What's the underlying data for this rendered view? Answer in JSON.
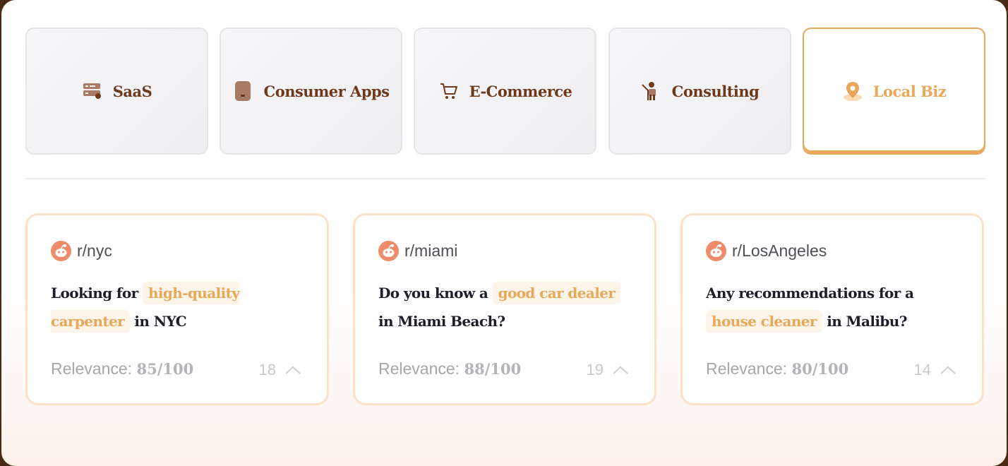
{
  "tabs": [
    {
      "label": "SaaS",
      "icon": "server-icon",
      "active": false
    },
    {
      "label": "Consumer Apps",
      "icon": "phone-icon",
      "active": false
    },
    {
      "label": "E-Commerce",
      "icon": "cart-icon",
      "active": false
    },
    {
      "label": "Consulting",
      "icon": "presenter-icon",
      "active": false
    },
    {
      "label": "Local Biz",
      "icon": "map-pin-icon",
      "active": true
    }
  ],
  "cards": [
    {
      "subreddit": "r/nyc",
      "text_before": "Looking for ",
      "highlight": "high-quality carpenter",
      "text_after": " in NYC",
      "relevance_label": "Relevance: ",
      "relevance_value": "85/100",
      "votes": "18"
    },
    {
      "subreddit": "r/miami",
      "text_before": "Do you know a ",
      "highlight": "good car dealer",
      "text_after": " in Miami Beach?",
      "relevance_label": "Relevance: ",
      "relevance_value": "88/100",
      "votes": "19"
    },
    {
      "subreddit": "r/LosAngeles",
      "text_before": "Any recommendations for a ",
      "highlight": "house cleaner",
      "text_after": " in Malibu?",
      "relevance_label": "Relevance: ",
      "relevance_value": "80/100",
      "votes": "14"
    }
  ],
  "colors": {
    "accent": "#e8a85a",
    "brand_text": "#6e3a1e",
    "reddit": "#ee8b6b"
  }
}
